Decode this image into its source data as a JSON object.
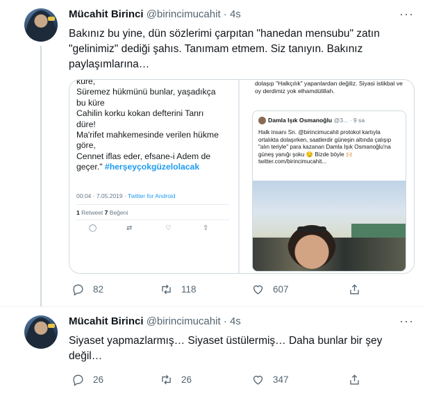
{
  "tweets": [
    {
      "name": "Mücahit Birinci",
      "handle": "@birincimucahit",
      "separator": "·",
      "time": "4s",
      "text": "Bakınız bu yine, dün sözlerimi çarpıtan \"hanedan mensubu\" zatın \"gelinimiz\" dediği şahıs. Tanımam etmem. Siz tanıyın. Bakınız paylaşımlarına…",
      "replies": "82",
      "retweets": "118",
      "likes": "607"
    },
    {
      "name": "Mücahit Birinci",
      "handle": "@birincimucahit",
      "separator": "·",
      "time": "4s",
      "text": "Siyaset yapmazlarmış… Siyaset üstülermiş… Daha bunlar bir şey değil…",
      "replies": "26",
      "retweets": "26",
      "likes": "347"
    }
  ],
  "media": {
    "left": {
      "poem_lines": [
        "küre,",
        "Süremez hükmünü bunlar, yaşadıkça",
        "bu küre",
        "Cahilin korku kokan defterini Tanrı",
        "düre!",
        "Ma'rifet mahkemesinde verilen hükme",
        "göre,",
        "Cennet iflas eder, efsane-i Adem de",
        "geçer.\""
      ],
      "hashtag": "#herşeyçokgüzelolacak",
      "timestamp": "00:04 · 7.05.2019 · ",
      "source": "Twitter for Android",
      "retweet_count": "1",
      "retweet_label": "Retweet",
      "like_count": "7",
      "like_label": "Beğeni"
    },
    "right": {
      "top_text": "dolaşıp \"Halkçılık\" yapanlardan değiliz. Siyasi istikbal ve oy derdimiz yok elhamdülillah.",
      "quote_name": "Damla Işık Osmanoğlu",
      "quote_handle": "@3... · 9 sa",
      "quote_text": "Halk insanı Sn. @birincimucahit protokol kartıyla ortalıkta dolaşırken, saatlerdir güneşin altında çalışıp \"alın teriyle\" para kazanan Damla Işık Osmanoğlu'na güneş yanığı şoku 😏 Bizde böyle 🙌🏻 twitter.com/birincimucahit..."
    }
  },
  "icons": [
    "reply-icon",
    "retweet-icon",
    "like-icon",
    "share-icon",
    "more-icon"
  ]
}
